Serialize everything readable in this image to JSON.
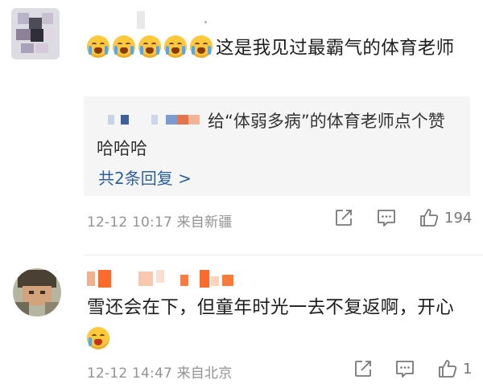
{
  "comments": [
    {
      "text": "这是我见过最霸气的体育老师",
      "reply_preview": {
        "text": "给“体弱多病”的体育老师点个赞哈哈哈",
        "more_label": "共2条回复 >"
      },
      "meta": "12-12 10:17  来自新疆",
      "actions": {
        "like_count": "194",
        "share_icon": "share-icon",
        "comment_icon": "comment-icon",
        "like_icon": "like-icon"
      }
    },
    {
      "text": "雪还会在下，但童年时光一去不复返啊，开心",
      "meta": "12-12 14:47  来自北京",
      "actions": {
        "like_count": "1",
        "share_icon": "share-icon",
        "comment_icon": "comment-icon",
        "like_icon": "like-icon"
      }
    }
  ],
  "colors": {
    "link_blue": "#2b5fa8",
    "meta_gray": "#939393",
    "reply_bg": "#f5f5f5",
    "username_orange": "#ff6a2a"
  }
}
